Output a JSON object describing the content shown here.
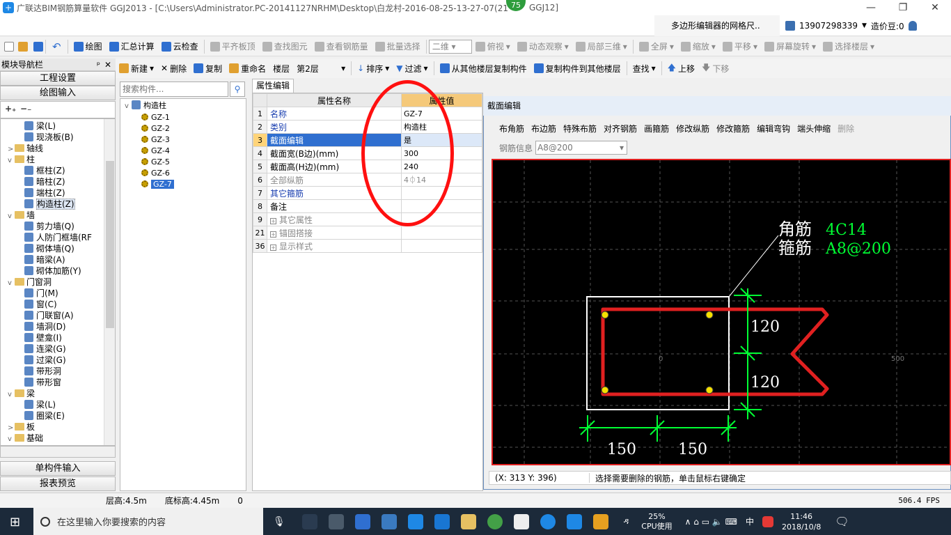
{
  "window": {
    "title": "广联达BIM钢筋算量软件 GGJ2013 - [C:\\Users\\Administrator.PC-20141127NRHM\\Desktop\\白龙村-2016-08-25-13-27-07(21",
    "title_tail": "GGJ12]",
    "badge": "75",
    "minimize": "—",
    "restore": "❐",
    "close": "✕"
  },
  "infobar": {
    "polygon_tip": "多边形编辑器的网格尺..",
    "phone": "13907298339",
    "price_bean": "造价豆:0"
  },
  "main_toolbar": [
    {
      "label": "绘图",
      "icon": "pen-icon",
      "enabled": true
    },
    {
      "label": "汇总计算",
      "icon": "sigma-icon",
      "enabled": true
    },
    {
      "label": "云检查",
      "icon": "cloud-icon",
      "enabled": true
    },
    {
      "label": "平齐板顶",
      "icon": "align-icon",
      "enabled": false
    },
    {
      "label": "查找图元",
      "icon": "find-icon",
      "enabled": false
    },
    {
      "label": "查看钢筋量",
      "icon": "rebar-icon",
      "enabled": false
    },
    {
      "label": "批量选择",
      "icon": "select-icon",
      "enabled": false
    },
    {
      "label": "俯视",
      "icon": "top-view-icon",
      "enabled": false
    },
    {
      "label": "动态观察",
      "icon": "orbit-icon",
      "enabled": false
    },
    {
      "label": "局部三维",
      "icon": "3d-icon",
      "enabled": false
    },
    {
      "label": "全屏",
      "icon": "fullscreen-icon",
      "enabled": false
    },
    {
      "label": "缩放",
      "icon": "zoom-icon",
      "enabled": false
    },
    {
      "label": "平移",
      "icon": "pan-icon",
      "enabled": false
    },
    {
      "label": "屏幕旋转",
      "icon": "rotate-icon",
      "enabled": false
    },
    {
      "label": "选择楼层",
      "icon": "floor-icon",
      "enabled": false
    }
  ],
  "view_mode": "二维",
  "comp_toolbar": {
    "new": "新建",
    "delete": "删除",
    "copy": "复制",
    "rename": "重命名",
    "floor_label": "楼层",
    "floor_value": "第2层",
    "sort": "排序",
    "filter": "过滤",
    "copy_from": "从其他楼层复制构件",
    "copy_to": "复制构件到其他楼层",
    "find": "查找",
    "up": "上移",
    "down": "下移"
  },
  "nav": {
    "header": "模块导航栏",
    "pin": "ᵖ",
    "close": "✕",
    "project_settings": "工程设置",
    "drawing_input": "绘图输入",
    "single_input": "单构件输入",
    "report_preview": "报表预览",
    "tree": [
      {
        "label": "梁(L)",
        "level": 2,
        "type": "leaf"
      },
      {
        "label": "现浇板(B)",
        "level": 2,
        "type": "leaf"
      },
      {
        "label": "轴线",
        "level": 1,
        "type": "folder",
        "exp": ">"
      },
      {
        "label": "柱",
        "level": 1,
        "type": "folder",
        "exp": "v"
      },
      {
        "label": "框柱(Z)",
        "level": 2,
        "type": "leaf"
      },
      {
        "label": "暗柱(Z)",
        "level": 2,
        "type": "leaf"
      },
      {
        "label": "端柱(Z)",
        "level": 2,
        "type": "leaf"
      },
      {
        "label": "构造柱(Z)",
        "level": 2,
        "type": "leaf",
        "selected": true
      },
      {
        "label": "墙",
        "level": 1,
        "type": "folder",
        "exp": "v"
      },
      {
        "label": "剪力墙(Q)",
        "level": 2,
        "type": "leaf"
      },
      {
        "label": "人防门框墙(RF",
        "level": 2,
        "type": "leaf"
      },
      {
        "label": "砌体墙(Q)",
        "level": 2,
        "type": "leaf"
      },
      {
        "label": "暗梁(A)",
        "level": 2,
        "type": "leaf"
      },
      {
        "label": "砌体加筋(Y)",
        "level": 2,
        "type": "leaf"
      },
      {
        "label": "门窗洞",
        "level": 1,
        "type": "folder",
        "exp": "v"
      },
      {
        "label": "门(M)",
        "level": 2,
        "type": "leaf"
      },
      {
        "label": "窗(C)",
        "level": 2,
        "type": "leaf"
      },
      {
        "label": "门联窗(A)",
        "level": 2,
        "type": "leaf"
      },
      {
        "label": "墙洞(D)",
        "level": 2,
        "type": "leaf"
      },
      {
        "label": "壁龛(I)",
        "level": 2,
        "type": "leaf"
      },
      {
        "label": "连梁(G)",
        "level": 2,
        "type": "leaf"
      },
      {
        "label": "过梁(G)",
        "level": 2,
        "type": "leaf"
      },
      {
        "label": "带形洞",
        "level": 2,
        "type": "leaf"
      },
      {
        "label": "带形窗",
        "level": 2,
        "type": "leaf"
      },
      {
        "label": "梁",
        "level": 1,
        "type": "folder",
        "exp": "v"
      },
      {
        "label": "梁(L)",
        "level": 2,
        "type": "leaf"
      },
      {
        "label": "圈梁(E)",
        "level": 2,
        "type": "leaf"
      },
      {
        "label": "板",
        "level": 1,
        "type": "folder",
        "exp": ">"
      },
      {
        "label": "基础",
        "level": 1,
        "type": "folder",
        "exp": "v"
      }
    ]
  },
  "comp_search_placeholder": "搜索构件...",
  "comp_tree": {
    "root": "构造柱",
    "items": [
      "GZ-1",
      "GZ-2",
      "GZ-3",
      "GZ-4",
      "GZ-5",
      "GZ-6",
      "GZ-7"
    ],
    "selected": "GZ-7"
  },
  "attr_tab": "属性编辑",
  "attr_table": {
    "header_name": "属性名称",
    "header_value": "属性值",
    "rows": [
      {
        "num": "1",
        "name": "名称",
        "value": "GZ-7",
        "style": "blue"
      },
      {
        "num": "2",
        "name": "类别",
        "value": "构造柱",
        "style": "blue"
      },
      {
        "num": "3",
        "name": "截面编辑",
        "value": "是",
        "style": "hl"
      },
      {
        "num": "4",
        "name": "截面宽(B边)(mm)",
        "value": "300",
        "style": ""
      },
      {
        "num": "5",
        "name": "截面高(H边)(mm)",
        "value": "240",
        "style": ""
      },
      {
        "num": "6",
        "name": "全部纵筋",
        "value": "4⏀14",
        "style": "gray"
      },
      {
        "num": "7",
        "name": "其它箍筋",
        "value": "",
        "style": "blue"
      },
      {
        "num": "8",
        "name": "备注",
        "value": "",
        "style": ""
      },
      {
        "num": "9",
        "name": "其它属性",
        "value": "",
        "style": "gray",
        "plus": true
      },
      {
        "num": "21",
        "name": "锚固搭接",
        "value": "",
        "style": "gray",
        "plus": true
      },
      {
        "num": "36",
        "name": "显示样式",
        "value": "",
        "style": "gray",
        "plus": true
      }
    ]
  },
  "section_editor": {
    "title": "截面编辑",
    "toolbar": [
      "布角筋",
      "布边筋",
      "特殊布筋",
      "对齐钢筋",
      "画箍筋",
      "修改纵筋",
      "修改箍筋",
      "编辑弯钩",
      "端头伸缩",
      "删除"
    ],
    "rebar_info_label": "钢筋信息",
    "rebar_info_value": "A8@200",
    "corner_label": "角筋",
    "corner_value": "4C14",
    "stirrup_label": "箍筋",
    "stirrup_value": "A8@200",
    "dim_h1": "120",
    "dim_h2": "120",
    "dim_w1": "150",
    "dim_w2": "150",
    "axis_zero": "0",
    "axis_500": "500",
    "coords": "(X: 313 Y: 396)",
    "hint": "选择需要删除的钢筋，单击鼠标右键确定"
  },
  "statusbar": {
    "floor_height": "层高:4.5m",
    "base_height": "底标高:4.45m",
    "zero": "0",
    "fps": "506.4 FPS"
  },
  "taskbar": {
    "search": "在这里输入你要搜索的内容",
    "cpu_pct": "25%",
    "cpu_label": "CPU使用",
    "ime": "中",
    "time": "11:46",
    "date": "2018/10/8"
  },
  "colors": {
    "accent": "#2f6fd0",
    "annotation": "#ff1010",
    "canvas_bg": "#000000",
    "rebar": "#e02020",
    "dim": "#00ff33"
  }
}
